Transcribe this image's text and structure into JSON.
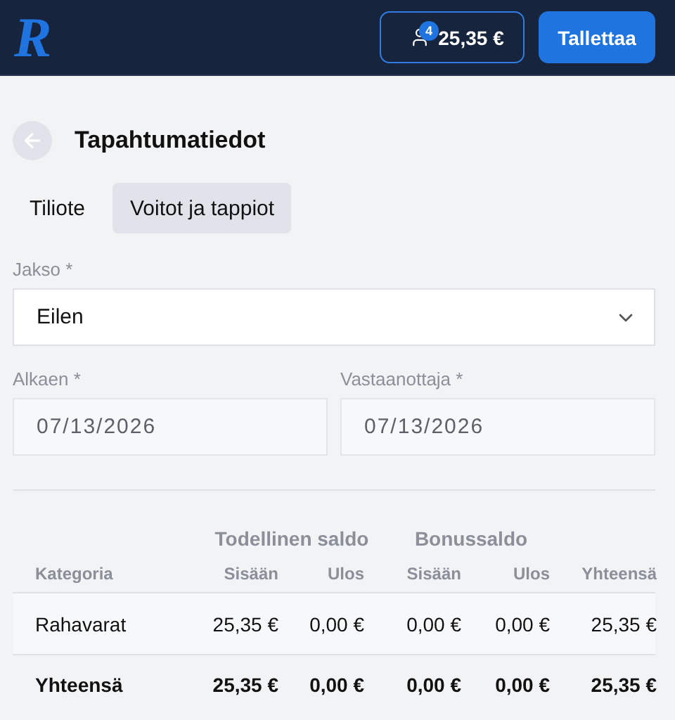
{
  "header": {
    "logo": "R",
    "balance": {
      "badge": "4",
      "amount": "25,35 €"
    },
    "deposit_button": "Tallettaa"
  },
  "page": {
    "title": "Tapahtumatiedot"
  },
  "tabs": [
    {
      "label": "Tiliote",
      "selected": false
    },
    {
      "label": "Voitot ja tappiot",
      "selected": true
    }
  ],
  "period": {
    "label": "Jakso *",
    "value": "Eilen"
  },
  "dates": [
    {
      "label": "Alkaen *",
      "value": "07/13/2026",
      "disabled": true
    },
    {
      "label": "Vastaanottaja *",
      "value": "07/13/2026",
      "disabled": true
    }
  ],
  "table": {
    "groups": [
      "Todellinen saldo",
      "Bonussaldo"
    ],
    "columns": [
      "Kategoria",
      "Sisään",
      "Ulos",
      "Sisään",
      "Ulos",
      "Yhteensä"
    ],
    "rows": [
      {
        "kind": "data",
        "cells": [
          "Rahavarat",
          "25,35 €",
          "0,00 €",
          "0,00 €",
          "0,00 €",
          "25,35 €"
        ]
      },
      {
        "kind": "total",
        "cells": [
          "Yhteensä",
          "25,35 €",
          "0,00 €",
          "0,00 €",
          "0,00 €",
          "25,35 €"
        ]
      }
    ]
  }
}
